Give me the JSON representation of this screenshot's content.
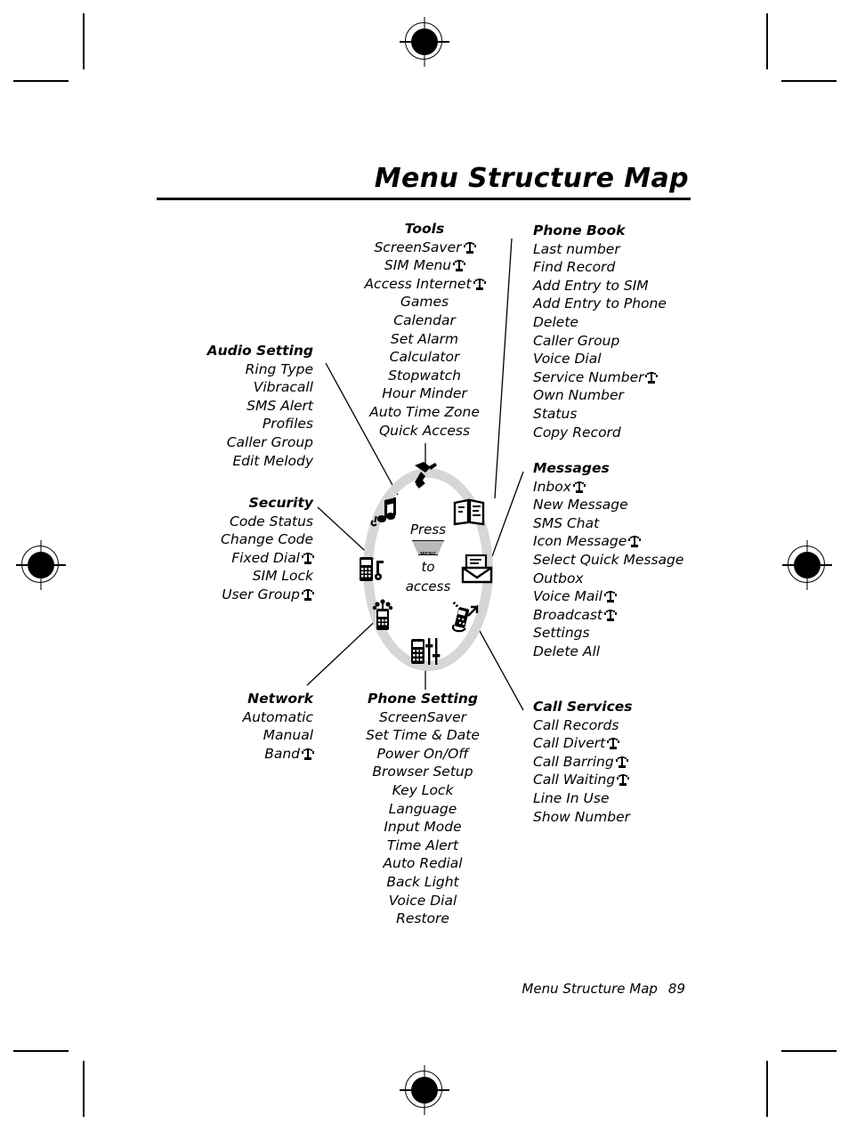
{
  "page": {
    "title": "Menu Structure Map",
    "footer_label": "Menu Structure Map",
    "footer_page": "89"
  },
  "center": {
    "line1": "Press",
    "key_label": "MENU",
    "line2": "to",
    "line3": "access"
  },
  "colors": {
    "ring": "#d6d6d6",
    "text": "#000000",
    "page_bg": "#ffffff"
  },
  "icons": {
    "ring": [
      "hammer-tools-icon",
      "open-book-icon",
      "envelope-message-icon",
      "phone-call-arrow-icon",
      "phone-settings-slider-icon",
      "phone-network-icon",
      "phone-lock-security-icon",
      "music-notes-icon"
    ],
    "service_marker": "antenna-network-service-icon"
  },
  "groups": {
    "tools": {
      "heading": "Tools",
      "align": "center",
      "items": [
        {
          "label": "ScreenSaver",
          "icon": true
        },
        {
          "label": "SIM Menu",
          "icon": true
        },
        {
          "label": "Access Internet",
          "icon": true
        },
        {
          "label": "Games",
          "icon": false
        },
        {
          "label": "Calendar",
          "icon": false
        },
        {
          "label": "Set Alarm",
          "icon": false
        },
        {
          "label": "Calculator",
          "icon": false
        },
        {
          "label": "Stopwatch",
          "icon": false
        },
        {
          "label": "Hour Minder",
          "icon": false
        },
        {
          "label": "Auto Time Zone",
          "icon": false
        },
        {
          "label": "Quick Access",
          "icon": false
        }
      ]
    },
    "phone_book": {
      "heading": "Phone Book",
      "align": "left",
      "items": [
        {
          "label": "Last number",
          "icon": false
        },
        {
          "label": "Find Record",
          "icon": false
        },
        {
          "label": "Add Entry to SIM",
          "icon": false
        },
        {
          "label": "Add Entry to Phone",
          "icon": false
        },
        {
          "label": "Delete",
          "icon": false
        },
        {
          "label": "Caller Group",
          "icon": false
        },
        {
          "label": "Voice Dial",
          "icon": false
        },
        {
          "label": "Service Number",
          "icon": true
        },
        {
          "label": "Own Number",
          "icon": false
        },
        {
          "label": "Status",
          "icon": false
        },
        {
          "label": "Copy Record",
          "icon": false
        }
      ]
    },
    "messages": {
      "heading": "Messages",
      "align": "left",
      "items": [
        {
          "label": "Inbox",
          "icon": true
        },
        {
          "label": "New Message",
          "icon": false
        },
        {
          "label": "SMS Chat",
          "icon": false
        },
        {
          "label": "Icon Message",
          "icon": true
        },
        {
          "label": "Select Quick Message",
          "icon": false
        },
        {
          "label": "Outbox",
          "icon": false
        },
        {
          "label": "Voice Mail",
          "icon": true
        },
        {
          "label": "Broadcast",
          "icon": true
        },
        {
          "label": "Settings",
          "icon": false
        },
        {
          "label": "Delete All",
          "icon": false
        }
      ]
    },
    "call_services": {
      "heading": "Call Services",
      "align": "left",
      "items": [
        {
          "label": "Call Records",
          "icon": false
        },
        {
          "label": "Call Divert",
          "icon": true
        },
        {
          "label": "Call Barring",
          "icon": true
        },
        {
          "label": "Call Waiting",
          "icon": true
        },
        {
          "label": "Line In Use",
          "icon": false
        },
        {
          "label": "Show Number",
          "icon": false
        }
      ]
    },
    "audio_setting": {
      "heading": "Audio Setting",
      "align": "right",
      "items": [
        {
          "label": "Ring Type",
          "icon": false
        },
        {
          "label": "Vibracall",
          "icon": false
        },
        {
          "label": "SMS Alert",
          "icon": false
        },
        {
          "label": "Profiles",
          "icon": false
        },
        {
          "label": "Caller Group",
          "icon": false
        },
        {
          "label": "Edit Melody",
          "icon": false
        }
      ]
    },
    "security": {
      "heading": "Security",
      "align": "right",
      "items": [
        {
          "label": "Code Status",
          "icon": false
        },
        {
          "label": "Change Code",
          "icon": false
        },
        {
          "label": "Fixed Dial",
          "icon": true
        },
        {
          "label": "SIM Lock",
          "icon": false
        },
        {
          "label": "User Group",
          "icon": true
        }
      ]
    },
    "network": {
      "heading": "Network",
      "align": "right",
      "items": [
        {
          "label": "Automatic",
          "icon": false
        },
        {
          "label": "Manual",
          "icon": false
        },
        {
          "label": "Band",
          "icon": true
        }
      ]
    },
    "phone_setting": {
      "heading": "Phone Setting",
      "align": "center",
      "items": [
        {
          "label": "ScreenSaver",
          "icon": false
        },
        {
          "label": "Set Time & Date",
          "icon": false
        },
        {
          "label": "Power On/Off",
          "icon": false
        },
        {
          "label": "Browser Setup",
          "icon": false
        },
        {
          "label": "Key Lock",
          "icon": false
        },
        {
          "label": "Language",
          "icon": false
        },
        {
          "label": "Input Mode",
          "icon": false
        },
        {
          "label": "Time Alert",
          "icon": false
        },
        {
          "label": "Auto Redial",
          "icon": false
        },
        {
          "label": "Back Light",
          "icon": false
        },
        {
          "label": "Voice Dial",
          "icon": false
        },
        {
          "label": "Restore",
          "icon": false
        }
      ]
    }
  }
}
